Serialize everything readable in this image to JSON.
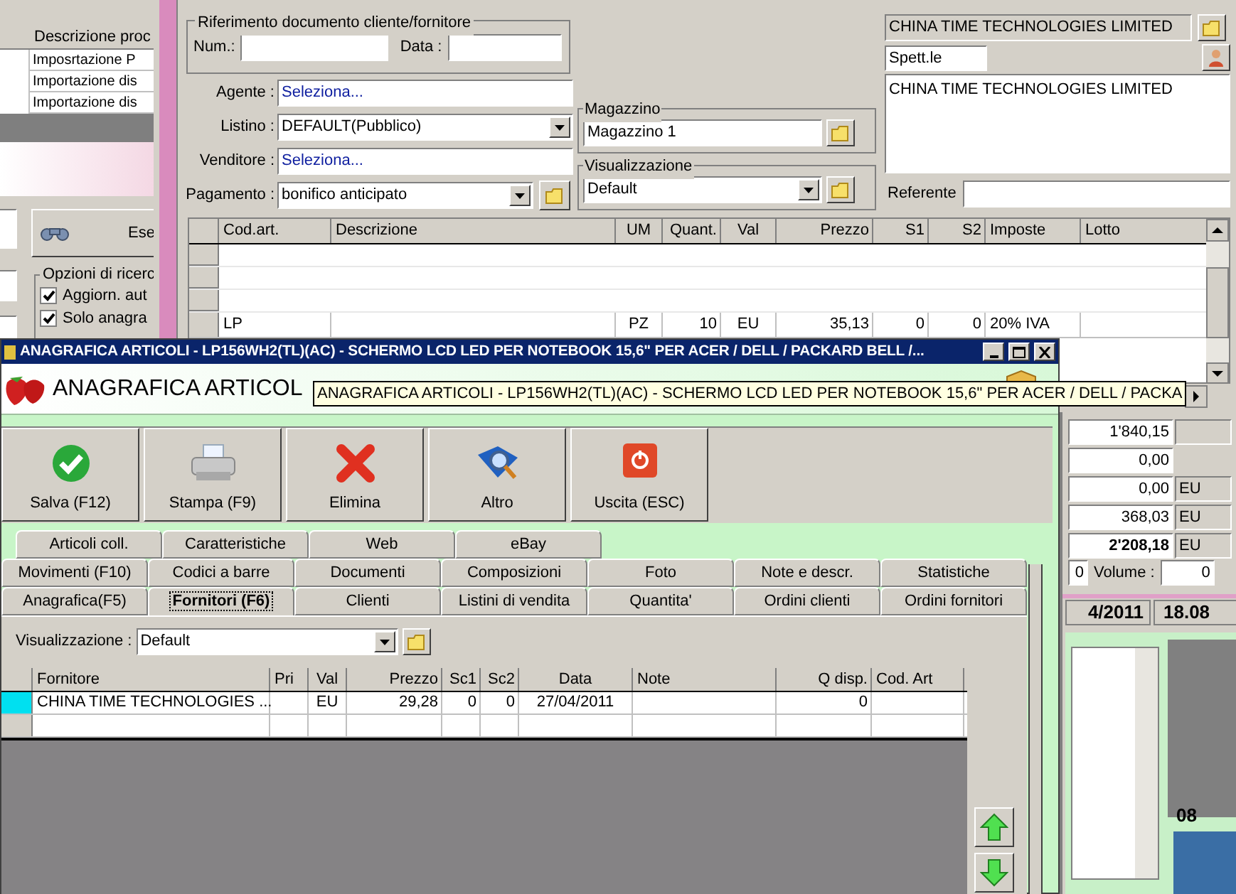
{
  "back_window": {
    "table_header": "Descrizione proc",
    "rows": [
      "Imposrtazione P",
      "Importazione dis",
      "Importazione dis"
    ],
    "search_button": "Ese",
    "options_group": "Opzioni di ricerc",
    "options": [
      {
        "label": "Aggiorn. aut",
        "checked": true
      },
      {
        "label": "Solo anagra",
        "checked": true
      }
    ]
  },
  "document_window": {
    "reference_group": "Riferimento documento cliente/fornitore",
    "num_label": "Num.:",
    "data_label": "Data :",
    "fields": [
      {
        "label": "Agente :",
        "value": "Seleziona...",
        "kind": "link"
      },
      {
        "label": "Listino :",
        "value": "DEFAULT(Pubblico)",
        "kind": "dropdown"
      },
      {
        "label": "Venditore :",
        "value": "Seleziona...",
        "kind": "link"
      },
      {
        "label": "Pagamento :",
        "value": "bonifico anticipato",
        "kind": "dropdown_folder"
      }
    ],
    "magazzino": {
      "label": "Magazzino",
      "value": "Magazzino 1"
    },
    "visualizzazione": {
      "label": "Visualizzazione",
      "value": "Default"
    },
    "customer": {
      "name": "CHINA TIME TECHNOLOGIES LIMITED",
      "salutation": "Spett.le",
      "address": "CHINA TIME TECHNOLOGIES LIMITED",
      "referente_label": "Referente"
    },
    "lines_table": {
      "columns": [
        "Cod.art.",
        "Descrizione",
        "UM",
        "Quant.",
        "Val",
        "Prezzo",
        "S1",
        "S2",
        "Imposte",
        "Lotto"
      ],
      "rows": [
        [
          "LP",
          null,
          "PZ",
          "10",
          "EU",
          "35,13",
          "0",
          "0",
          "20% IVA",
          null
        ]
      ]
    },
    "totals": [
      {
        "value": "1'840,15",
        "bold": false
      },
      {
        "value": "0,00",
        "bold": false
      },
      {
        "value": "0,00",
        "currency": "EU",
        "bold": false
      },
      {
        "value": "368,03",
        "currency": "EU",
        "bold": false
      },
      {
        "value": "2'208,18",
        "currency": "EU",
        "bold": true
      }
    ],
    "weight_value": "0",
    "volume_label": "Volume :",
    "volume_value": "0",
    "date": "4/2011",
    "time": "18.08",
    "lower_time": "08"
  },
  "article_window": {
    "title": "ANAGRAFICA ARTICOLI - LP156WH2(TL)(AC) - SCHERMO LCD LED PER NOTEBOOK 15,6\" PER ACER / DELL / PACKARD BELL /...",
    "header": "ANAGRAFICA ARTICOL",
    "tooltip": "ANAGRAFICA ARTICOLI - LP156WH2(TL)(AC) - SCHERMO LCD LED PER NOTEBOOK 15,6\" PER ACER / DELL / PACKA",
    "toolbar": [
      {
        "label": "Salva (F12)",
        "kind": "save"
      },
      {
        "label": "Stampa (F9)",
        "kind": "print"
      },
      {
        "label": "Elimina",
        "kind": "delete"
      },
      {
        "label": "Altro",
        "kind": "more"
      },
      {
        "label": "Uscita (ESC)",
        "kind": "exit"
      }
    ],
    "tab_rows": [
      [
        {
          "label": "Articoli coll.",
          "selected": false
        },
        {
          "label": "Caratteristiche",
          "selected": false
        },
        {
          "label": "Web",
          "selected": false
        },
        {
          "label": "eBay",
          "selected": false
        }
      ],
      [
        {
          "label": "Movimenti (F10)",
          "selected": false
        },
        {
          "label": "Codici a barre",
          "selected": false
        },
        {
          "label": "Documenti",
          "selected": false
        },
        {
          "label": "Composizioni",
          "selected": false
        },
        {
          "label": "Foto",
          "selected": false
        },
        {
          "label": "Note e descr.",
          "selected": false
        },
        {
          "label": "Statistiche",
          "selected": false
        }
      ],
      [
        {
          "label": "Anagrafica(F5)",
          "selected": false
        },
        {
          "label": "Fornitori (F6)",
          "selected": true
        },
        {
          "label": "Clienti",
          "selected": false
        },
        {
          "label": "Listini di vendita",
          "selected": false
        },
        {
          "label": "Quantita'",
          "selected": false
        },
        {
          "label": "Ordini clienti",
          "selected": false
        },
        {
          "label": "Ordini fornitori",
          "selected": false
        }
      ]
    ],
    "visualizzazione": {
      "label": "Visualizzazione :",
      "value": "Default"
    },
    "suppliers_table": {
      "columns": [
        "Fornitore",
        "Pri",
        "Val",
        "Prezzo",
        "Sc1",
        "Sc2",
        "Data",
        "Note",
        "Q disp.",
        "Cod. Art"
      ],
      "rows": [
        {
          "selected": true,
          "cells": [
            "CHINA TIME TECHNOLOGIES ...",
            null,
            "EU",
            "29,28",
            "0",
            "0",
            "27/04/2011",
            null,
            "0",
            null
          ]
        },
        {
          "selected": false,
          "cells": [
            null,
            null,
            null,
            null,
            null,
            null,
            null,
            null,
            null,
            null
          ]
        }
      ]
    }
  }
}
